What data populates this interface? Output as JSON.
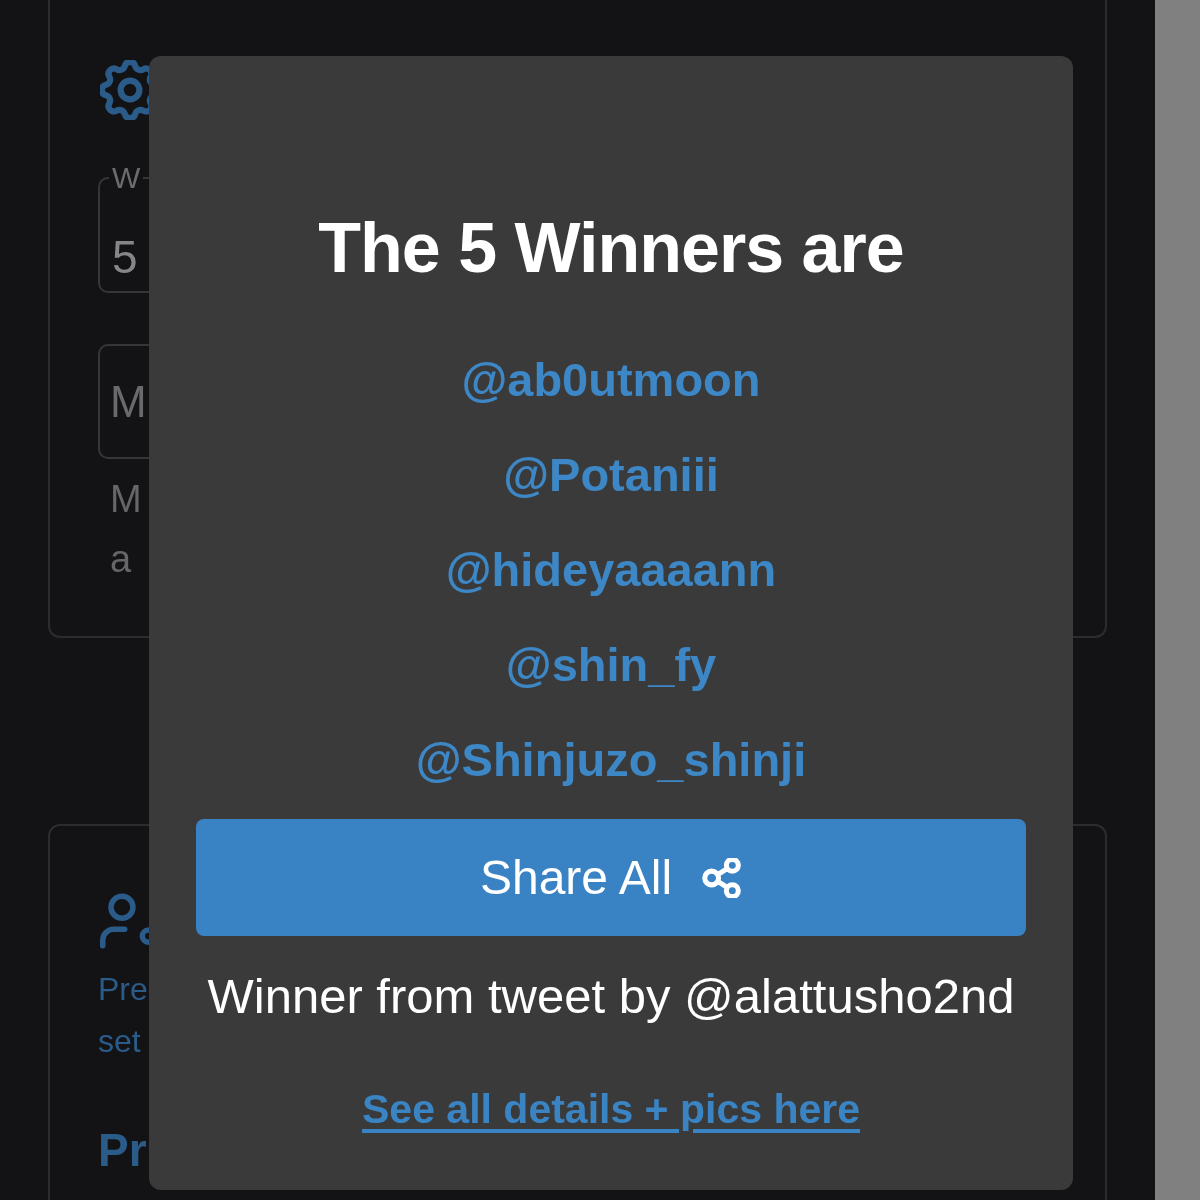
{
  "background": {
    "settings_card": {
      "field": {
        "label": "W",
        "value": "5"
      },
      "field_2": {
        "placeholder": "M"
      },
      "helper_text_lines": [
        "M",
        "a"
      ]
    },
    "profile_card": {
      "description_lines": [
        "Pre",
        "set"
      ],
      "heading": "Pr"
    }
  },
  "modal": {
    "title": "The 5 Winners are",
    "winners": [
      "@ab0utmoon",
      "@Potaniii",
      "@hideyaaaann",
      "@shin_fy",
      "@Shinjuzo_shinji"
    ],
    "share_button": {
      "label": "Share All"
    },
    "credit": "Winner from tweet by @alattusho2nd",
    "details_link": "See all details + pics here"
  }
}
